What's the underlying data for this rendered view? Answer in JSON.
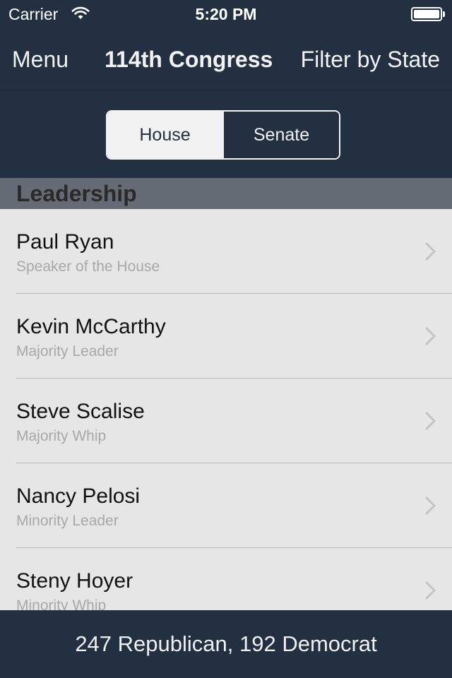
{
  "status_bar": {
    "carrier": "Carrier",
    "time": "5:20 PM"
  },
  "nav": {
    "left_button": "Menu",
    "title": "114th Congress",
    "right_button": "Filter by State"
  },
  "segments": {
    "house_label": "House",
    "senate_label": "Senate",
    "selected": "House"
  },
  "section": {
    "title": "Leadership"
  },
  "leaders": [
    {
      "name": "Paul Ryan",
      "role": "Speaker of the House"
    },
    {
      "name": "Kevin McCarthy",
      "role": "Majority Leader"
    },
    {
      "name": "Steve Scalise",
      "role": "Majority Whip"
    },
    {
      "name": "Nancy Pelosi",
      "role": "Minority Leader"
    },
    {
      "name": "Steny Hoyer",
      "role": "Minority Whip"
    }
  ],
  "footer": {
    "summary": "247 Republican, 192 Democrat"
  },
  "colors": {
    "navy": "#223042",
    "section_header": "#656b74",
    "list_background": "#e6e6e6"
  },
  "icons": {
    "wifi": "wifi-icon",
    "battery": "battery-icon",
    "row_disclosure": "chevron-right-icon"
  }
}
